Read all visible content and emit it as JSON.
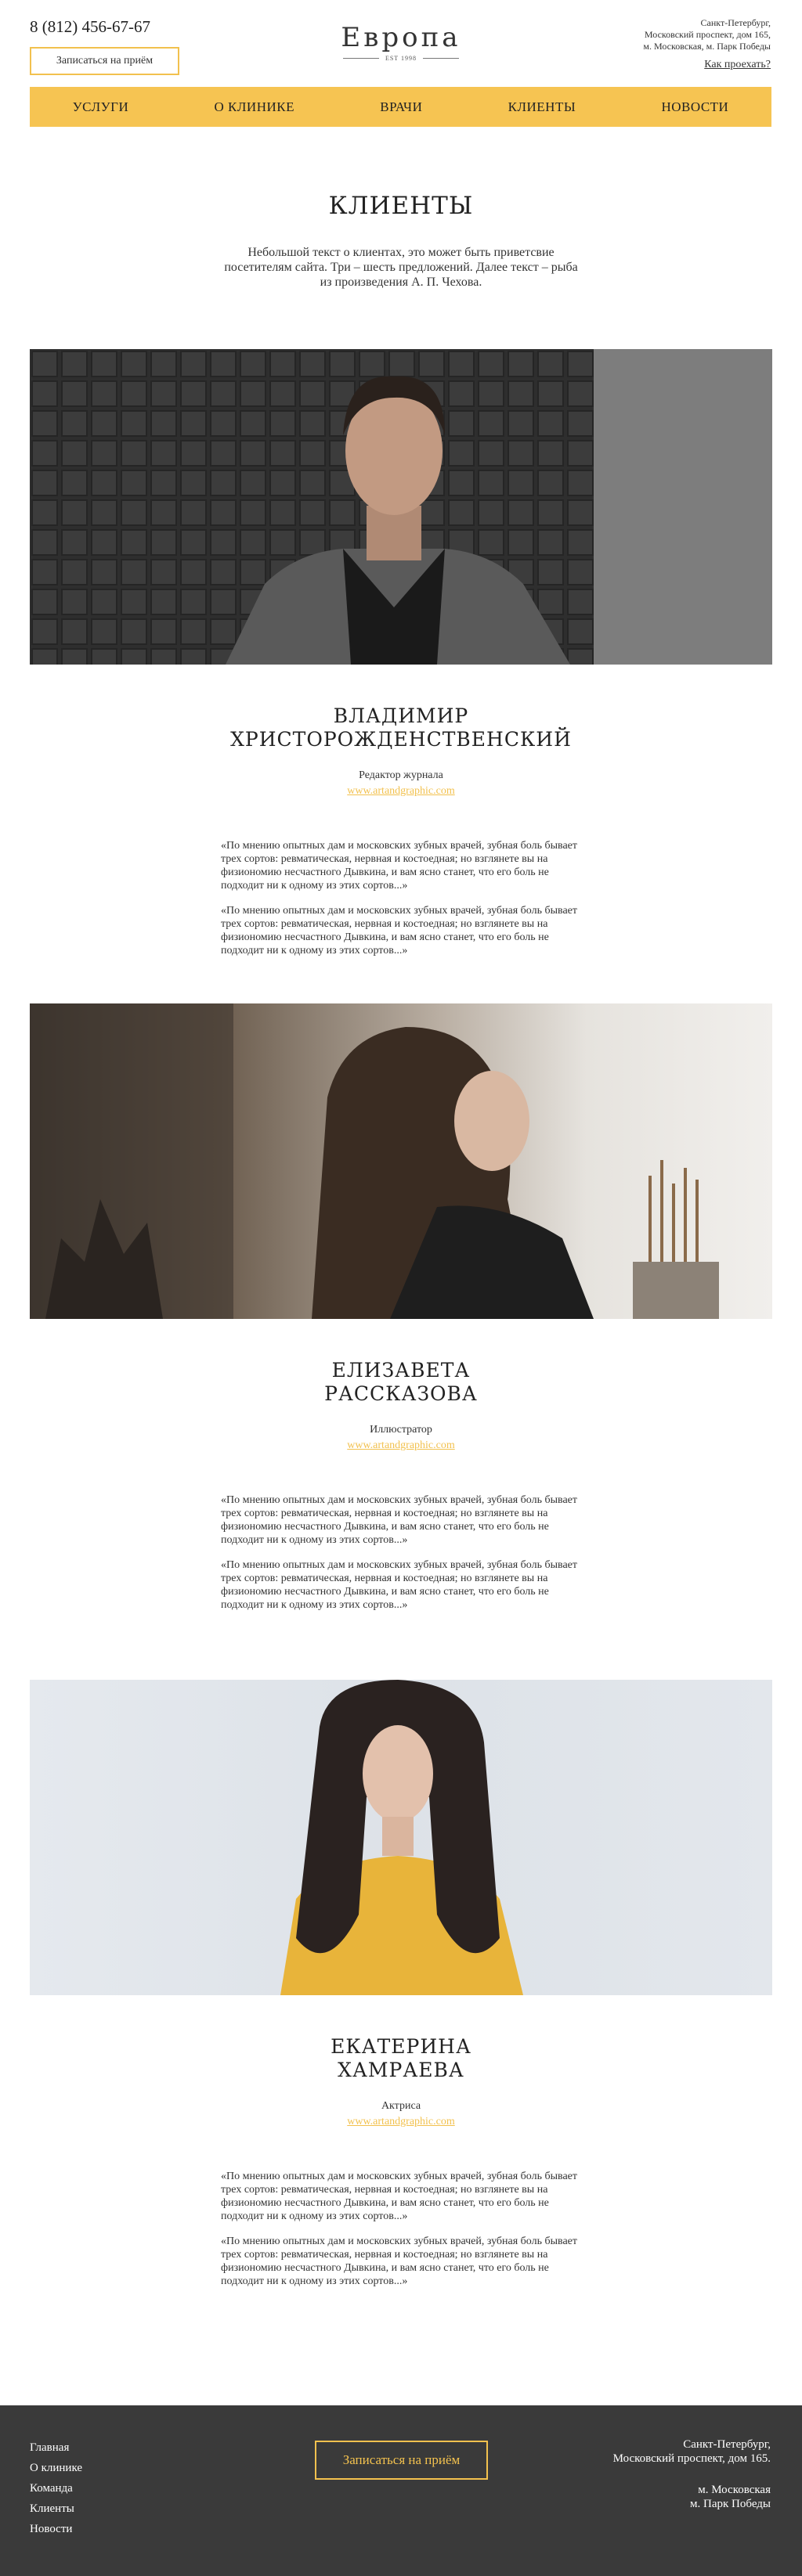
{
  "header": {
    "phone": "8 (812) 456-67-67",
    "book_button": "Записаться на приём",
    "logo_text": "Европа",
    "logo_sub": "EST 1998",
    "address_lines": [
      "Санкт-Петербург,",
      "Московский проспект, дом 165,",
      "м. Московская, м. Парк Победы"
    ],
    "directions_link": "Как проехать?"
  },
  "nav": {
    "items": [
      "УСЛУГИ",
      "О КЛИНИКЕ",
      "ВРАЧИ",
      "КЛИЕНТЫ",
      "НОВОСТИ"
    ]
  },
  "page": {
    "title": "КЛИЕНТЫ",
    "intro": "Небольшой текст о клиентах, это может быть приветсвие посетителям сайта. Три – шесть предложений. Далее текст – рыба из произведения А. П. Чехова."
  },
  "clients": [
    {
      "name_line1": "ВЛАДИМИР",
      "name_line2": "ХРИСТОРОЖДЕНСТВЕНСКИЙ",
      "role": "Редактор журнала",
      "link": "www.artandgraphic.com",
      "quote1": "«По мнению опытных дам и московских зубных врачей, зубная боль бывает трех сортов: ревматическая, нервная и костоедная; но взглянете вы на физиономию несчастного Дывкина, и вам ясно станет, что его боль не подходит ни к одному из этих сортов...»",
      "quote2": "«По мнению опытных дам и московских зубных врачей, зубная боль бывает трех сортов: ревматическая, нервная и костоедная; но взглянете вы на физиономию несчастного Дывкина, и вам ясно станет, что его боль не подходит ни к одному из этих сортов...»"
    },
    {
      "name_line1": "ЕЛИЗАВЕТА",
      "name_line2": "РАССКАЗОВА",
      "role": "Иллюстратор",
      "link": "www.artandgraphic.com",
      "quote1": "«По мнению опытных дам и московских зубных врачей, зубная боль бывает трех сортов: ревматическая, нервная и костоедная; но взглянете вы на физиономию несчастного Дывкина, и вам ясно станет, что его боль не подходит ни к одному из этих сортов...»",
      "quote2": "«По мнению опытных дам и московских зубных врачей, зубная боль бывает трех сортов: ревматическая, нервная и костоедная; но взглянете вы на физиономию несчастного Дывкина, и вам ясно станет, что его боль не подходит ни к одному из этих сортов...»"
    },
    {
      "name_line1": "ЕКАТЕРИНА",
      "name_line2": "ХАМРАЕВА",
      "role": "Актриса",
      "link": "www.artandgraphic.com",
      "quote1": "«По мнению опытных дам и московских зубных врачей, зубная боль бывает трех сортов: ревматическая, нервная и костоедная; но взглянете вы на физиономию несчастного Дывкина, и вам ясно станет, что его боль не подходит ни к одному из этих сортов...»",
      "quote2": "«По мнению опытных дам и московских зубных врачей, зубная боль бывает трех сортов: ревматическая, нервная и костоедная; но взглянете вы на физиономию несчастного Дывкина, и вам ясно станет, что его боль не подходит ни к одному из этих сортов...»"
    }
  ],
  "footer": {
    "nav": [
      "Главная",
      "О клинике",
      "Команда",
      "Клиенты",
      "Новости"
    ],
    "book_button": "Записаться на приём",
    "address_lines": [
      "Санкт-Петербург,",
      "Московский проспект, дом 165."
    ],
    "metro_lines": [
      "м. Московская",
      "м. Парк Победы"
    ]
  },
  "colors": {
    "accent": "#f6c452",
    "footer_bg": "#3a3a3a"
  }
}
